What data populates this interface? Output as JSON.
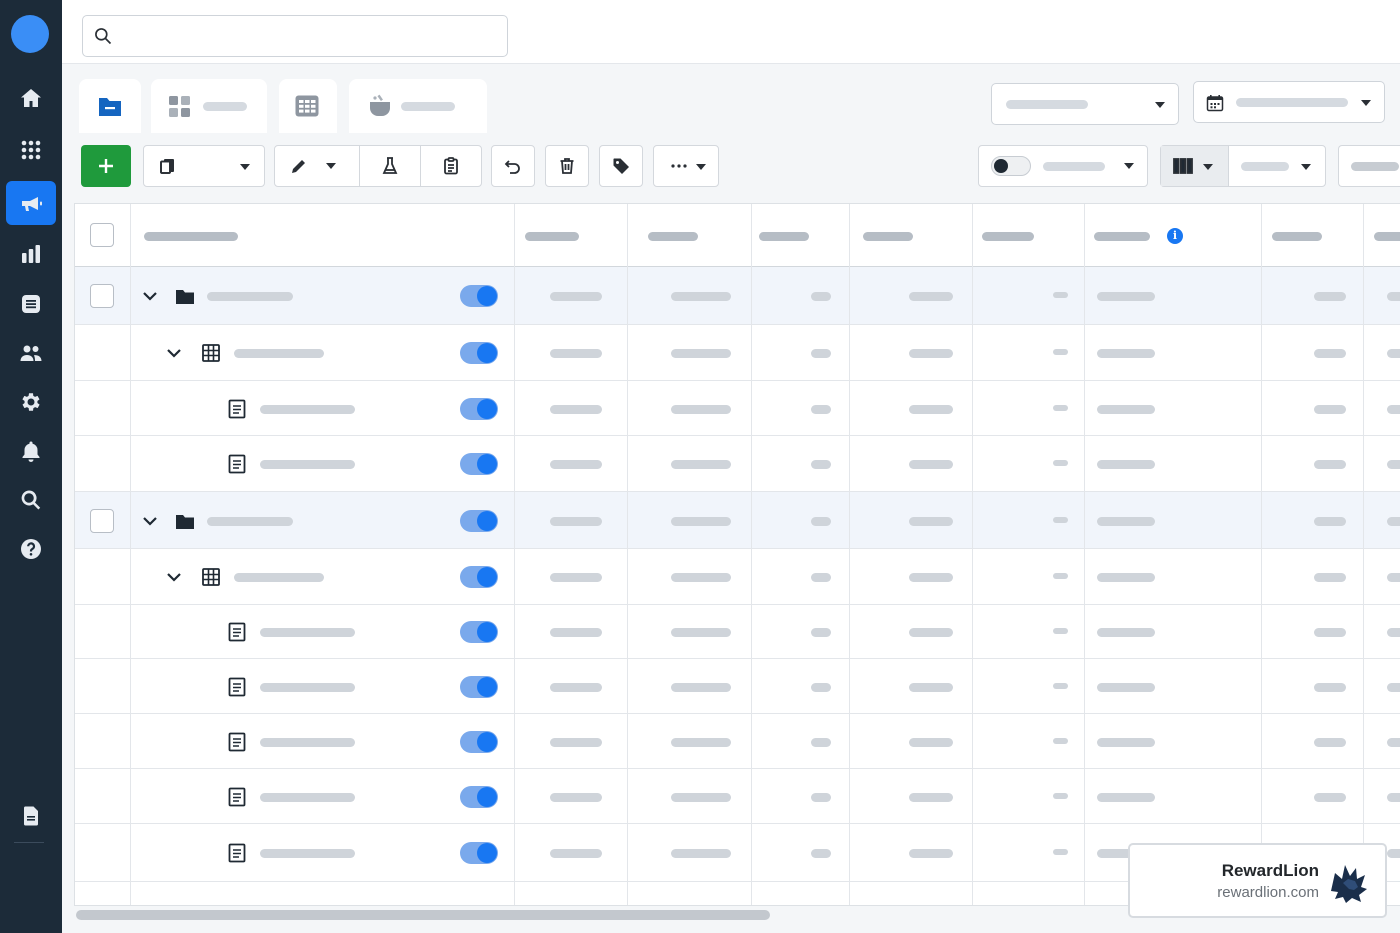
{
  "sidebar": {
    "items": [
      {
        "icon": "home-icon"
      },
      {
        "icon": "apps-grid-icon"
      },
      {
        "icon": "megaphone-icon",
        "active": true
      },
      {
        "icon": "bar-chart-icon"
      },
      {
        "icon": "list-icon"
      },
      {
        "icon": "people-icon"
      },
      {
        "icon": "gear-icon"
      },
      {
        "icon": "bell-icon"
      },
      {
        "icon": "search-icon"
      },
      {
        "icon": "help-icon"
      },
      {
        "icon": "page-icon"
      }
    ]
  },
  "search": {
    "placeholder": ""
  },
  "tabs": [
    {
      "icon": "folder-icon",
      "label": ""
    },
    {
      "icon": "adsets-icon",
      "label": ""
    },
    {
      "icon": "table-icon",
      "label": ""
    },
    {
      "icon": "ad-icon",
      "label": ""
    }
  ],
  "table": {
    "info_icon": "info-icon",
    "rows": [
      {
        "level": "campaign",
        "icon": "folder-icon",
        "toggle_on": true
      },
      {
        "level": "adset",
        "icon": "grid-icon",
        "toggle_on": true
      },
      {
        "level": "ad",
        "icon": "document-icon",
        "toggle_on": true
      },
      {
        "level": "ad",
        "icon": "document-icon",
        "toggle_on": true
      },
      {
        "level": "campaign",
        "icon": "folder-icon",
        "toggle_on": true
      },
      {
        "level": "adset",
        "icon": "grid-icon",
        "toggle_on": true
      },
      {
        "level": "ad",
        "icon": "document-icon",
        "toggle_on": true
      },
      {
        "level": "ad",
        "icon": "document-icon",
        "toggle_on": true
      },
      {
        "level": "ad",
        "icon": "document-icon",
        "toggle_on": true
      },
      {
        "level": "ad",
        "icon": "document-icon",
        "toggle_on": true
      },
      {
        "level": "ad",
        "icon": "document-icon",
        "toggle_on": true
      }
    ]
  },
  "watermark": {
    "name": "RewardLion",
    "url": "rewardlion.com"
  },
  "colors": {
    "sidebar_bg": "#1c2b39",
    "accent": "#1877f2",
    "add_button": "#1f9a3c"
  }
}
